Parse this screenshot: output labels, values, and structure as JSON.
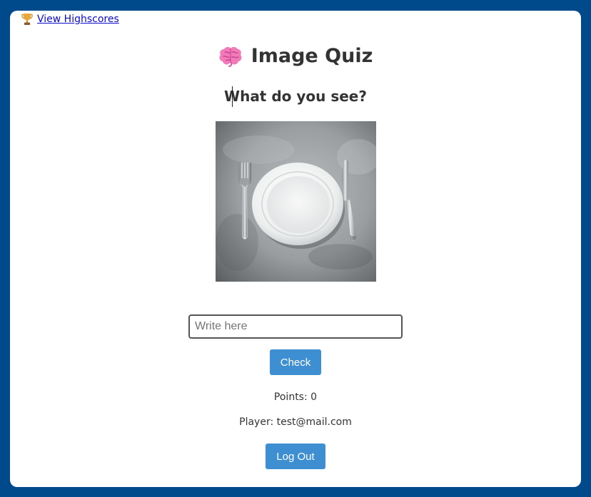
{
  "header": {
    "highscores_link": "View Highscores",
    "title": "Image Quiz"
  },
  "quiz": {
    "question": "What do you see?",
    "image_subject": "white plate with fork and knife on grey stone table",
    "input_value": "",
    "input_placeholder": "Write here",
    "check_label": "Check"
  },
  "status": {
    "points": "Points: 0",
    "player": "Player: test@mail.com"
  },
  "actions": {
    "logout_label": "Log Out"
  },
  "icons": {
    "highscores": "trophy-icon",
    "title": "brain-icon"
  },
  "colors": {
    "page_background": "#004a8b",
    "card_background": "#ffffff",
    "button": "#3d8fd1",
    "link": "#0b0bcc",
    "text": "#333333"
  }
}
